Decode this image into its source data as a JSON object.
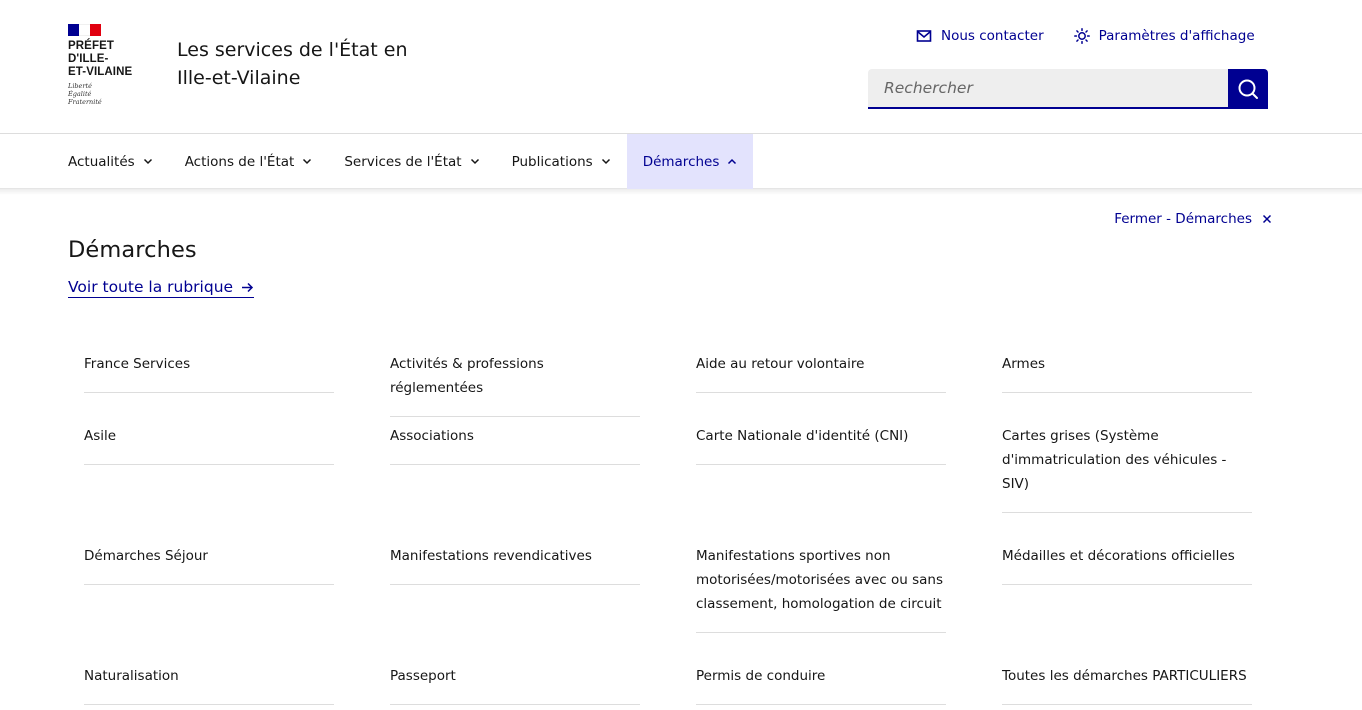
{
  "header": {
    "logo_title_lines": [
      "PRÉFET",
      "D'ILLE-",
      "ET-VILAINE"
    ],
    "motto_lines": [
      "Liberté",
      "Égalité",
      "Fraternité"
    ],
    "site_title_line1": "Les services de l'État en",
    "site_title_line2": "Ille-et-Vilaine",
    "contact_label": "Nous contacter",
    "contact_icon": "mail-icon",
    "display_settings_label": "Paramètres d'affichage",
    "display_settings_icon": "sun-icon",
    "search_placeholder": "Rechercher",
    "search_icon": "search-icon"
  },
  "nav": {
    "items": [
      {
        "label": "Actualités",
        "state": "collapsed"
      },
      {
        "label": "Actions de l'État",
        "state": "collapsed"
      },
      {
        "label": "Services de l'État",
        "state": "collapsed"
      },
      {
        "label": "Publications",
        "state": "collapsed"
      },
      {
        "label": "Démarches",
        "state": "expanded"
      }
    ]
  },
  "menu": {
    "close_label": "Fermer - Démarches",
    "title": "Démarches",
    "see_all_label": "Voir toute la rubrique",
    "items": [
      {
        "label": "France Services"
      },
      {
        "label": "Activités & professions réglementées"
      },
      {
        "label": "Aide au retour volontaire"
      },
      {
        "label": "Armes"
      },
      {
        "label": "Asile"
      },
      {
        "label": "Associations"
      },
      {
        "label": "Carte Nationale d'identité (CNI)"
      },
      {
        "label": "Cartes grises (Système d'immatriculation des véhicules - SIV)"
      },
      {
        "label": "Démarches Séjour"
      },
      {
        "label": "Manifestations revendicatives"
      },
      {
        "label": "Manifestations sportives non motorisées/motorisées avec ou sans classement, homologation de circuit"
      },
      {
        "label": "Médailles et décorations officielles"
      },
      {
        "label": "Naturalisation"
      },
      {
        "label": "Passeport"
      },
      {
        "label": "Permis de conduire"
      },
      {
        "label": "Toutes les démarches PARTICULIERS"
      }
    ]
  },
  "colors": {
    "primary_blue": "#000091",
    "flag_red": "#e1000f",
    "active_nav_bg": "#e3e3fd",
    "search_bg": "#eeeeee"
  }
}
